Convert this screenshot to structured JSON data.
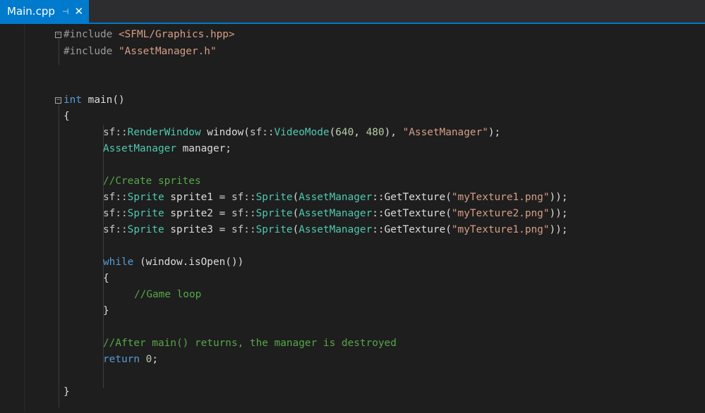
{
  "tab": {
    "filename": "Main.cpp",
    "pin_icon": "⊣",
    "close_icon": "✕"
  },
  "code": {
    "include1_directive": "#include",
    "include1_path": "<SFML/Graphics.hpp>",
    "include2_directive": "#include",
    "include2_path": "\"AssetManager.h\"",
    "main_kw": "int",
    "main_rest": " main()",
    "brace_open": "{",
    "rw_ns": "sf::",
    "rw_type": "RenderWindow",
    "rw_mid": " window(",
    "rw_ns2": "sf::",
    "rw_vm": "VideoMode",
    "rw_paren": "(",
    "rw_640": "640",
    "rw_comma": ", ",
    "rw_480": "480",
    "rw_close": "), ",
    "rw_str": "\"AssetManager\"",
    "rw_end": ");",
    "am_type": "AssetManager",
    "am_rest": " manager;",
    "comment_create": "//Create sprites",
    "spr_ns": "sf::",
    "spr_type": "Sprite",
    "spr_eq": " = ",
    "spr_ctor_ns": "sf::",
    "spr_ctor": "Sprite",
    "spr_open": "(",
    "spr_am": "AssetManager",
    "spr_get": "::GetTexture(",
    "spr_close": "));",
    "sprite1_name": " sprite1",
    "sprite1_tex": "\"myTexture1.png\"",
    "sprite2_name": " sprite2",
    "sprite2_tex": "\"myTexture2.png\"",
    "sprite3_name": " sprite3",
    "sprite3_tex": "\"myTexture1.png\"",
    "while_kw": "while",
    "while_rest": " (window.isOpen())",
    "inner_open": "{",
    "comment_loop": "//Game loop",
    "inner_close": "}",
    "comment_after": "//After main() returns, the manager is destroyed",
    "return_kw": "return",
    "return_sp": " ",
    "return_val": "0",
    "return_end": ";",
    "brace_close": "}"
  },
  "colors": {
    "background": "#1e1e1e",
    "tab_active": "#007acc",
    "keyword": "#569cd6",
    "string": "#d69d85",
    "comment": "#57a64a",
    "type": "#4ec9b0",
    "preprocessor": "#9b9b9b"
  }
}
